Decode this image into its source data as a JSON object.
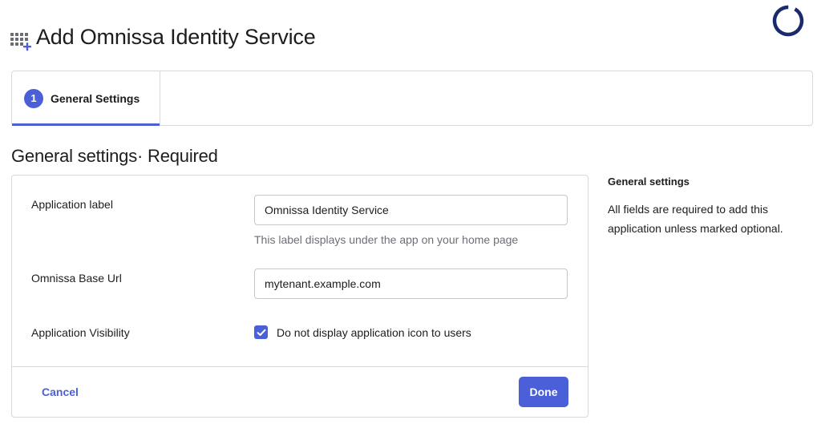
{
  "header": {
    "title": "Add Omnissa Identity Service",
    "app_icon": "app-grid-add-icon",
    "brand_logo": "omnissa-ring-logo"
  },
  "stepper": {
    "steps": [
      {
        "number": "1",
        "label": "General Settings",
        "active": true
      }
    ]
  },
  "section": {
    "title": "General settings· Required"
  },
  "form": {
    "fields": {
      "application_label": {
        "label": "Application label",
        "value": "Omnissa Identity Service",
        "help": "This label displays under the app on your home page"
      },
      "base_url": {
        "label": "Omnissa Base Url",
        "value": "mytenant.example.com"
      },
      "visibility": {
        "label": "Application Visibility",
        "checkbox_label": "Do not display application icon to users",
        "checked": true
      }
    },
    "actions": {
      "cancel_label": "Cancel",
      "done_label": "Done"
    }
  },
  "side_panel": {
    "title": "General settings",
    "text": "All fields are required to add this application unless marked optional."
  },
  "colors": {
    "accent": "#4b5fd9",
    "logo": "#1a2a6c",
    "border": "#d7d7dc",
    "muted_text": "#6e6e78"
  }
}
